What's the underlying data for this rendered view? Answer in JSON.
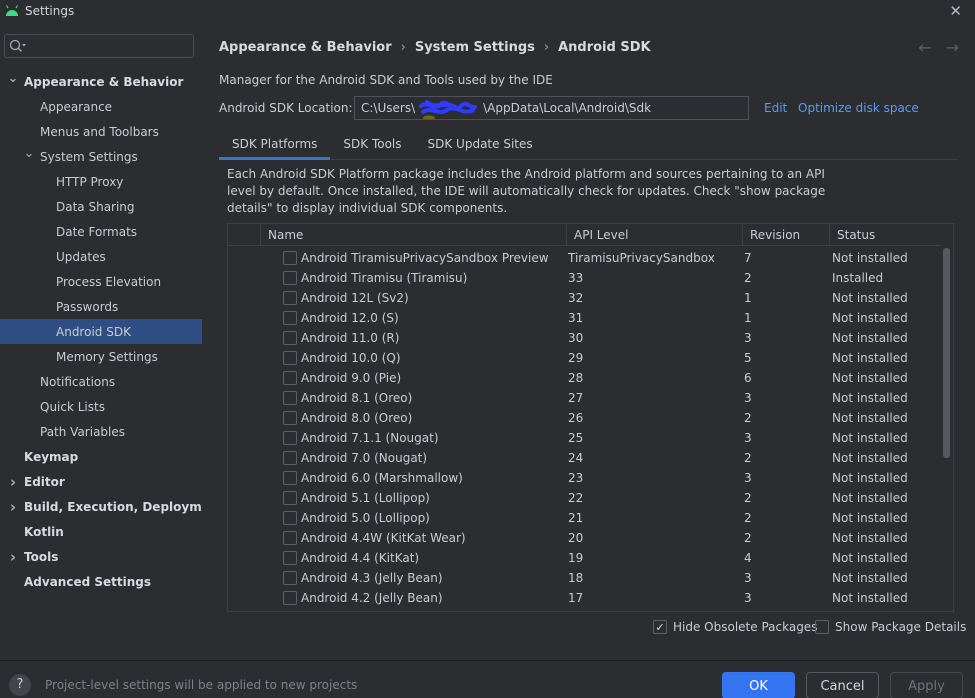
{
  "window": {
    "title": "Settings"
  },
  "search": {
    "placeholder": ""
  },
  "sidebar": {
    "items": [
      {
        "label": "Appearance & Behavior",
        "level": 0,
        "bold": true,
        "expanded": true,
        "arrow": "down"
      },
      {
        "label": "Appearance",
        "level": 1
      },
      {
        "label": "Menus and Toolbars",
        "level": 1
      },
      {
        "label": "System Settings",
        "level": 1,
        "expanded": true,
        "arrow": "down"
      },
      {
        "label": "HTTP Proxy",
        "level": 2
      },
      {
        "label": "Data Sharing",
        "level": 2
      },
      {
        "label": "Date Formats",
        "level": 2
      },
      {
        "label": "Updates",
        "level": 2
      },
      {
        "label": "Process Elevation",
        "level": 2
      },
      {
        "label": "Passwords",
        "level": 2
      },
      {
        "label": "Android SDK",
        "level": 2,
        "selected": true
      },
      {
        "label": "Memory Settings",
        "level": 2
      },
      {
        "label": "Notifications",
        "level": 1
      },
      {
        "label": "Quick Lists",
        "level": 1
      },
      {
        "label": "Path Variables",
        "level": 1
      },
      {
        "label": "Keymap",
        "level": 0,
        "bold": true
      },
      {
        "label": "Editor",
        "level": 0,
        "bold": true,
        "arrow": "right"
      },
      {
        "label": "Build, Execution, Deployment",
        "level": 0,
        "bold": true,
        "arrow": "right"
      },
      {
        "label": "Kotlin",
        "level": 0,
        "bold": true
      },
      {
        "label": "Tools",
        "level": 0,
        "bold": true,
        "arrow": "right"
      },
      {
        "label": "Advanced Settings",
        "level": 0,
        "bold": true
      }
    ]
  },
  "breadcrumb": [
    "Appearance & Behavior",
    "System Settings",
    "Android SDK"
  ],
  "main": {
    "description": "Manager for the Android SDK and Tools used by the IDE",
    "location_label": "Android SDK Location:",
    "location_prefix": "C:\\Users\\",
    "location_suffix": "\\AppData\\Local\\Android\\Sdk",
    "edit_link": "Edit",
    "optimize_link": "Optimize disk space",
    "tabs": [
      "SDK Platforms",
      "SDK Tools",
      "SDK Update Sites"
    ],
    "platforms_description": "Each Android SDK Platform package includes the Android platform and sources pertaining to an API level by default. Once installed, the IDE will automatically check for updates. Check \"show package details\" to display individual SDK components."
  },
  "table": {
    "headers": [
      "Name",
      "API Level",
      "Revision",
      "Status"
    ],
    "rows": [
      {
        "name": "Android TiramisuPrivacySandbox Preview",
        "api": "TiramisuPrivacySandbox",
        "rev": "7",
        "status": "Not installed"
      },
      {
        "name": "Android Tiramisu (Tiramisu)",
        "api": "33",
        "rev": "2",
        "status": "Installed"
      },
      {
        "name": "Android 12L (Sv2)",
        "api": "32",
        "rev": "1",
        "status": "Not installed"
      },
      {
        "name": "Android 12.0 (S)",
        "api": "31",
        "rev": "1",
        "status": "Not installed"
      },
      {
        "name": "Android 11.0 (R)",
        "api": "30",
        "rev": "3",
        "status": "Not installed"
      },
      {
        "name": "Android 10.0 (Q)",
        "api": "29",
        "rev": "5",
        "status": "Not installed"
      },
      {
        "name": "Android 9.0 (Pie)",
        "api": "28",
        "rev": "6",
        "status": "Not installed"
      },
      {
        "name": "Android 8.1 (Oreo)",
        "api": "27",
        "rev": "3",
        "status": "Not installed"
      },
      {
        "name": "Android 8.0 (Oreo)",
        "api": "26",
        "rev": "2",
        "status": "Not installed"
      },
      {
        "name": "Android 7.1.1 (Nougat)",
        "api": "25",
        "rev": "3",
        "status": "Not installed"
      },
      {
        "name": "Android 7.0 (Nougat)",
        "api": "24",
        "rev": "2",
        "status": "Not installed"
      },
      {
        "name": "Android 6.0 (Marshmallow)",
        "api": "23",
        "rev": "3",
        "status": "Not installed"
      },
      {
        "name": "Android 5.1 (Lollipop)",
        "api": "22",
        "rev": "2",
        "status": "Not installed"
      },
      {
        "name": "Android 5.0 (Lollipop)",
        "api": "21",
        "rev": "2",
        "status": "Not installed"
      },
      {
        "name": "Android 4.4W (KitKat Wear)",
        "api": "20",
        "rev": "2",
        "status": "Not installed"
      },
      {
        "name": "Android 4.4 (KitKat)",
        "api": "19",
        "rev": "4",
        "status": "Not installed"
      },
      {
        "name": "Android 4.3 (Jelly Bean)",
        "api": "18",
        "rev": "3",
        "status": "Not installed"
      },
      {
        "name": "Android 4.2 (Jelly Bean)",
        "api": "17",
        "rev": "3",
        "status": "Not installed"
      }
    ]
  },
  "options": {
    "hide_obsolete_label": "Hide Obsolete Packages",
    "hide_obsolete_checked": true,
    "show_details_label": "Show Package Details",
    "show_details_checked": false
  },
  "footer": {
    "note": "Project-level settings will be applied to new projects",
    "ok": "OK",
    "cancel": "Cancel",
    "apply": "Apply",
    "help": "?"
  },
  "colors": {
    "accent": "#3574f0",
    "selection": "#2f4e83",
    "link": "#589df6",
    "background": "#2b2d30"
  },
  "icons": {
    "app": "android-icon",
    "close": "close-icon",
    "search": "search-icon",
    "back": "back-arrow-icon",
    "forward": "forward-arrow-icon"
  }
}
